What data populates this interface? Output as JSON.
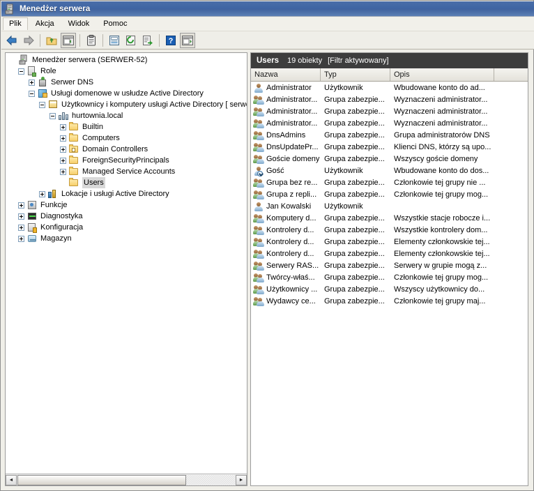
{
  "window": {
    "title": "Menedżer serwera",
    "title_icon": "server-manager-icon"
  },
  "menubar": {
    "items": [
      {
        "label": "Plik",
        "name": "menu-file",
        "active": true
      },
      {
        "label": "Akcja",
        "name": "menu-action",
        "active": false
      },
      {
        "label": "Widok",
        "name": "menu-view",
        "active": false
      },
      {
        "label": "Pomoc",
        "name": "menu-help",
        "active": false
      }
    ]
  },
  "toolbar": {
    "buttons": [
      {
        "name": "back-arrow-icon",
        "label": "Wstecz"
      },
      {
        "name": "forward-arrow-icon",
        "label": "Dalej"
      },
      {
        "name": "up-folder-icon",
        "label": "W górę"
      },
      {
        "name": "show-hide-tree-icon",
        "label": "Pokaż/ukryj drzewo",
        "pressed": true
      },
      {
        "name": "properties-clipboard-icon",
        "label": "Właściwości"
      },
      {
        "name": "list-view-icon",
        "label": "Widok listy"
      },
      {
        "name": "refresh-icon",
        "label": "Odśwież"
      },
      {
        "name": "export-list-icon",
        "label": "Eksportuj listę"
      },
      {
        "name": "help-icon",
        "label": "Pomoc"
      },
      {
        "name": "show-action-pane-icon",
        "label": "Okienko akcji"
      }
    ]
  },
  "tree": {
    "items": [
      {
        "label": "Menedżer serwera (SERWER-52)",
        "indent": 0,
        "expander": "none",
        "icon": "server-manager-icon",
        "selected": false
      },
      {
        "label": "Role",
        "indent": 1,
        "expander": "minus",
        "icon": "roles-icon",
        "selected": false
      },
      {
        "label": "Serwer DNS",
        "indent": 2,
        "expander": "plus",
        "icon": "dns-server-icon",
        "selected": false
      },
      {
        "label": "Usługi domenowe w usłudze Active Directory",
        "indent": 2,
        "expander": "minus",
        "icon": "ad-ds-icon",
        "selected": false
      },
      {
        "label": "Użytkownicy i komputery usługi Active Directory [ serwe",
        "indent": 3,
        "expander": "minus",
        "icon": "snapin-icon",
        "selected": false
      },
      {
        "label": "hurtownia.local",
        "indent": 4,
        "expander": "minus",
        "icon": "domain-icon",
        "selected": false
      },
      {
        "label": "Builtin",
        "indent": 5,
        "expander": "plus",
        "icon": "folder-icon",
        "selected": false
      },
      {
        "label": "Computers",
        "indent": 5,
        "expander": "plus",
        "icon": "folder-icon",
        "selected": false
      },
      {
        "label": "Domain Controllers",
        "indent": 5,
        "expander": "plus",
        "icon": "folder-dc-icon",
        "selected": false
      },
      {
        "label": "ForeignSecurityPrincipals",
        "indent": 5,
        "expander": "plus",
        "icon": "folder-icon",
        "selected": false
      },
      {
        "label": "Managed Service Accounts",
        "indent": 5,
        "expander": "plus",
        "icon": "folder-icon",
        "selected": false
      },
      {
        "label": "Users",
        "indent": 5,
        "expander": "none",
        "icon": "folder-icon",
        "selected": true
      },
      {
        "label": "Lokacje i usługi Active Directory",
        "indent": 3,
        "expander": "plus",
        "icon": "ad-sites-icon",
        "selected": false
      },
      {
        "label": "Funkcje",
        "indent": 1,
        "expander": "plus",
        "icon": "features-icon",
        "selected": false
      },
      {
        "label": "Diagnostyka",
        "indent": 1,
        "expander": "plus",
        "icon": "diagnostics-icon",
        "selected": false
      },
      {
        "label": "Konfiguracja",
        "indent": 1,
        "expander": "plus",
        "icon": "configuration-icon",
        "selected": false
      },
      {
        "label": "Magazyn",
        "indent": 1,
        "expander": "plus",
        "icon": "storage-icon",
        "selected": false
      }
    ],
    "hscrollbar": {
      "left_arrow": "◄",
      "right_arrow": "►"
    }
  },
  "list": {
    "header": {
      "title": "Users",
      "count": "19 obiekty",
      "filter": "[Filtr aktywowany]"
    },
    "columns": [
      {
        "label": "Nazwa",
        "name": "column-name"
      },
      {
        "label": "Typ",
        "name": "column-type"
      },
      {
        "label": "Opis",
        "name": "column-description"
      },
      {
        "label": "",
        "name": "column-spare"
      }
    ],
    "rows": [
      {
        "icon": "user-icon",
        "name": "Administrator",
        "type": "Użytkownik",
        "desc": "Wbudowane konto do ad..."
      },
      {
        "icon": "group-icon",
        "name": "Administrator...",
        "type": "Grupa zabezpie...",
        "desc": "Wyznaczeni administrator..."
      },
      {
        "icon": "group-icon",
        "name": "Administrator...",
        "type": "Grupa zabezpie...",
        "desc": "Wyznaczeni administrator..."
      },
      {
        "icon": "group-icon",
        "name": "Administrator...",
        "type": "Grupa zabezpie...",
        "desc": "Wyznaczeni administrator..."
      },
      {
        "icon": "group-icon",
        "name": "DnsAdmins",
        "type": "Grupa zabezpie...",
        "desc": "Grupa administratorów DNS"
      },
      {
        "icon": "group-icon",
        "name": "DnsUpdatePr...",
        "type": "Grupa zabezpie...",
        "desc": "Klienci DNS, którzy są upo..."
      },
      {
        "icon": "group-icon",
        "name": "Goście domeny",
        "type": "Grupa zabezpie...",
        "desc": "Wszyscy goście domeny"
      },
      {
        "icon": "user-disabled-icon",
        "name": "Gość",
        "type": "Użytkownik",
        "desc": "Wbudowane konto do dos..."
      },
      {
        "icon": "group-icon",
        "name": "Grupa bez re...",
        "type": "Grupa zabezpie...",
        "desc": "Członkowie tej grupy nie ..."
      },
      {
        "icon": "group-icon",
        "name": "Grupa z repli...",
        "type": "Grupa zabezpie...",
        "desc": "Członkowie tej grupy mog..."
      },
      {
        "icon": "user-icon",
        "name": "Jan Kowalski",
        "type": "Użytkownik",
        "desc": ""
      },
      {
        "icon": "group-icon",
        "name": "Komputery d...",
        "type": "Grupa zabezpie...",
        "desc": "Wszystkie stacje robocze i..."
      },
      {
        "icon": "group-icon",
        "name": "Kontrolery d...",
        "type": "Grupa zabezpie...",
        "desc": "Wszystkie kontrolery dom..."
      },
      {
        "icon": "group-icon",
        "name": "Kontrolery d...",
        "type": "Grupa zabezpie...",
        "desc": "Elementy członkowskie tej..."
      },
      {
        "icon": "group-icon",
        "name": "Kontrolery d...",
        "type": "Grupa zabezpie...",
        "desc": "Elementy członkowskie tej..."
      },
      {
        "icon": "group-icon",
        "name": "Serwery RAS...",
        "type": "Grupa zabezpie...",
        "desc": "Serwery w grupie mogą z..."
      },
      {
        "icon": "group-icon",
        "name": "Twórcy-właś...",
        "type": "Grupa zabezpie...",
        "desc": "Członkowie tej grupy mog..."
      },
      {
        "icon": "group-icon",
        "name": "Użytkownicy ...",
        "type": "Grupa zabezpie...",
        "desc": "Wszyscy użytkownicy do..."
      },
      {
        "icon": "group-icon",
        "name": "Wydawcy ce...",
        "type": "Grupa zabezpie...",
        "desc": "Członkowie tej grupy maj..."
      }
    ]
  },
  "colors": {
    "titlebar": "#41649f",
    "list_header_bg": "#3d3d3d",
    "window_bg": "#f0efe9",
    "selection": "#d8d8d8"
  }
}
